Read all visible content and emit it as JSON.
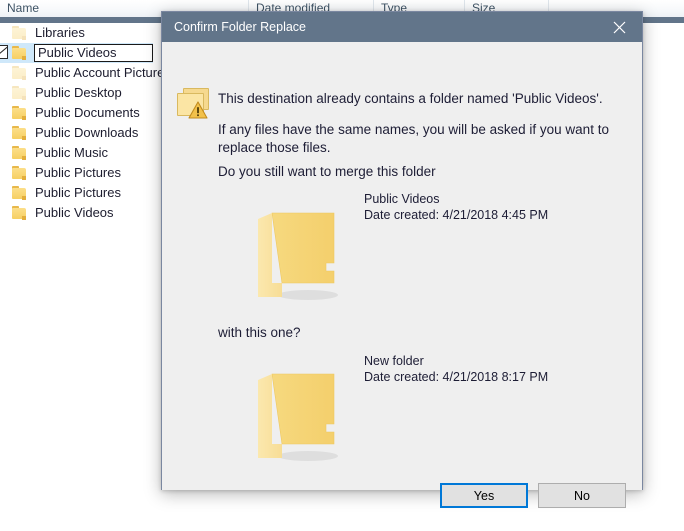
{
  "explorer": {
    "columns": [
      {
        "label": "Name"
      },
      {
        "label": "Date modified"
      },
      {
        "label": "Type"
      },
      {
        "label": "Size"
      }
    ],
    "rows": [
      {
        "name": "Libraries",
        "state": "ghost",
        "selected": false
      },
      {
        "name": "Public Videos",
        "state": "normal",
        "selected": true
      },
      {
        "name": "Public Account Pictures",
        "state": "ghost",
        "selected": false
      },
      {
        "name": "Public Desktop",
        "state": "ghost",
        "selected": false
      },
      {
        "name": "Public Documents",
        "state": "normal",
        "selected": false
      },
      {
        "name": "Public Downloads",
        "state": "normal",
        "selected": false
      },
      {
        "name": "Public Music",
        "state": "normal",
        "selected": false
      },
      {
        "name": "Public Pictures",
        "state": "normal",
        "selected": false
      },
      {
        "name": "Public Pictures",
        "state": "normal",
        "selected": false
      },
      {
        "name": "Public Videos",
        "state": "normal",
        "selected": false
      }
    ],
    "rename_value": "Public Videos",
    "selection_color": "#cfe8fa",
    "header_band_color": "#62758a"
  },
  "dialog": {
    "title": "Confirm Folder Replace",
    "titlebar_color": "#62758a",
    "body_color": "#efefef",
    "close_icon": "close-icon",
    "warning_icon": "folders-warning-icon",
    "messages": {
      "line1": "This destination already contains a folder named 'Public Videos'.",
      "line2": "If any files have the same names, you will be asked if you want to replace those files.",
      "line3": "Do you still want to merge this folder",
      "with_this_one": "with this one?"
    },
    "source_folder": {
      "name": "Public Videos",
      "date_created": "Date created: 4/21/2018 4:45 PM",
      "icon": "folder-icon"
    },
    "target_folder": {
      "name": "New folder",
      "date_created": "Date created: 4/21/2018 8:17 PM",
      "icon": "folder-icon"
    },
    "buttons": {
      "yes": "Yes",
      "no": "No",
      "focus_color": "#0078d7"
    }
  }
}
